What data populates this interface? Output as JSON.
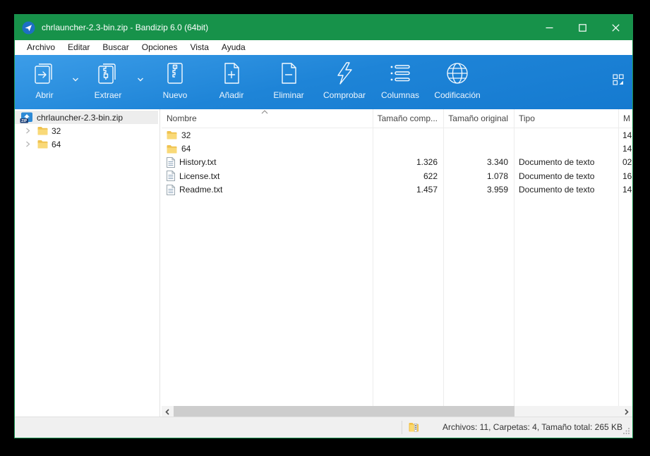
{
  "window": {
    "title": "chrlauncher-2.3-bin.zip - Bandizip 6.0 (64bit)"
  },
  "colors": {
    "titlebar_green": "#17924a",
    "toolbar_blue": "#1e84d7",
    "folder_yellow": "#f7d476",
    "selection_gray": "#ededed"
  },
  "menu": {
    "items": [
      "Archivo",
      "Editar",
      "Buscar",
      "Opciones",
      "Vista",
      "Ayuda"
    ]
  },
  "toolbar": {
    "buttons": [
      {
        "label": "Abrir",
        "icon": "open-archive",
        "has_dropdown": true
      },
      {
        "label": "Extraer",
        "icon": "extract-archive",
        "has_dropdown": true
      },
      {
        "label": "Nuevo",
        "icon": "new-archive",
        "has_dropdown": false
      },
      {
        "label": "Añadir",
        "icon": "add-files",
        "has_dropdown": false
      },
      {
        "label": "Eliminar",
        "icon": "delete-files",
        "has_dropdown": false
      },
      {
        "label": "Comprobar",
        "icon": "test-archive",
        "has_dropdown": false
      },
      {
        "label": "Columnas",
        "icon": "columns-list",
        "has_dropdown": false
      },
      {
        "label": "Codificación",
        "icon": "encoding-globe",
        "has_dropdown": false
      }
    ]
  },
  "sidebar": {
    "root": {
      "label": "chrlauncher-2.3-bin.zip",
      "icon": "zip-archive"
    },
    "items": [
      {
        "label": "32",
        "icon": "folder"
      },
      {
        "label": "64",
        "icon": "folder"
      }
    ]
  },
  "list": {
    "columns": [
      {
        "label": "Nombre",
        "sort": "asc"
      },
      {
        "label": "Tamaño comp..."
      },
      {
        "label": "Tamaño original"
      },
      {
        "label": "Tipo"
      },
      {
        "label": "M"
      }
    ],
    "rows": [
      {
        "name": "32",
        "icon": "folder",
        "compressed": "",
        "original": "",
        "type": "",
        "modified": "14"
      },
      {
        "name": "64",
        "icon": "folder",
        "compressed": "",
        "original": "",
        "type": "",
        "modified": "14"
      },
      {
        "name": "History.txt",
        "icon": "text-file",
        "compressed": "1.326",
        "original": "3.340",
        "type": "Documento de texto",
        "modified": "02"
      },
      {
        "name": "License.txt",
        "icon": "text-file",
        "compressed": "622",
        "original": "1.078",
        "type": "Documento de texto",
        "modified": "16"
      },
      {
        "name": "Readme.txt",
        "icon": "text-file",
        "compressed": "1.457",
        "original": "3.959",
        "type": "Documento de texto",
        "modified": "14"
      }
    ]
  },
  "statusbar": {
    "summary": "Archivos: 11, Carpetas: 4, Tamaño total: 265 KB"
  }
}
